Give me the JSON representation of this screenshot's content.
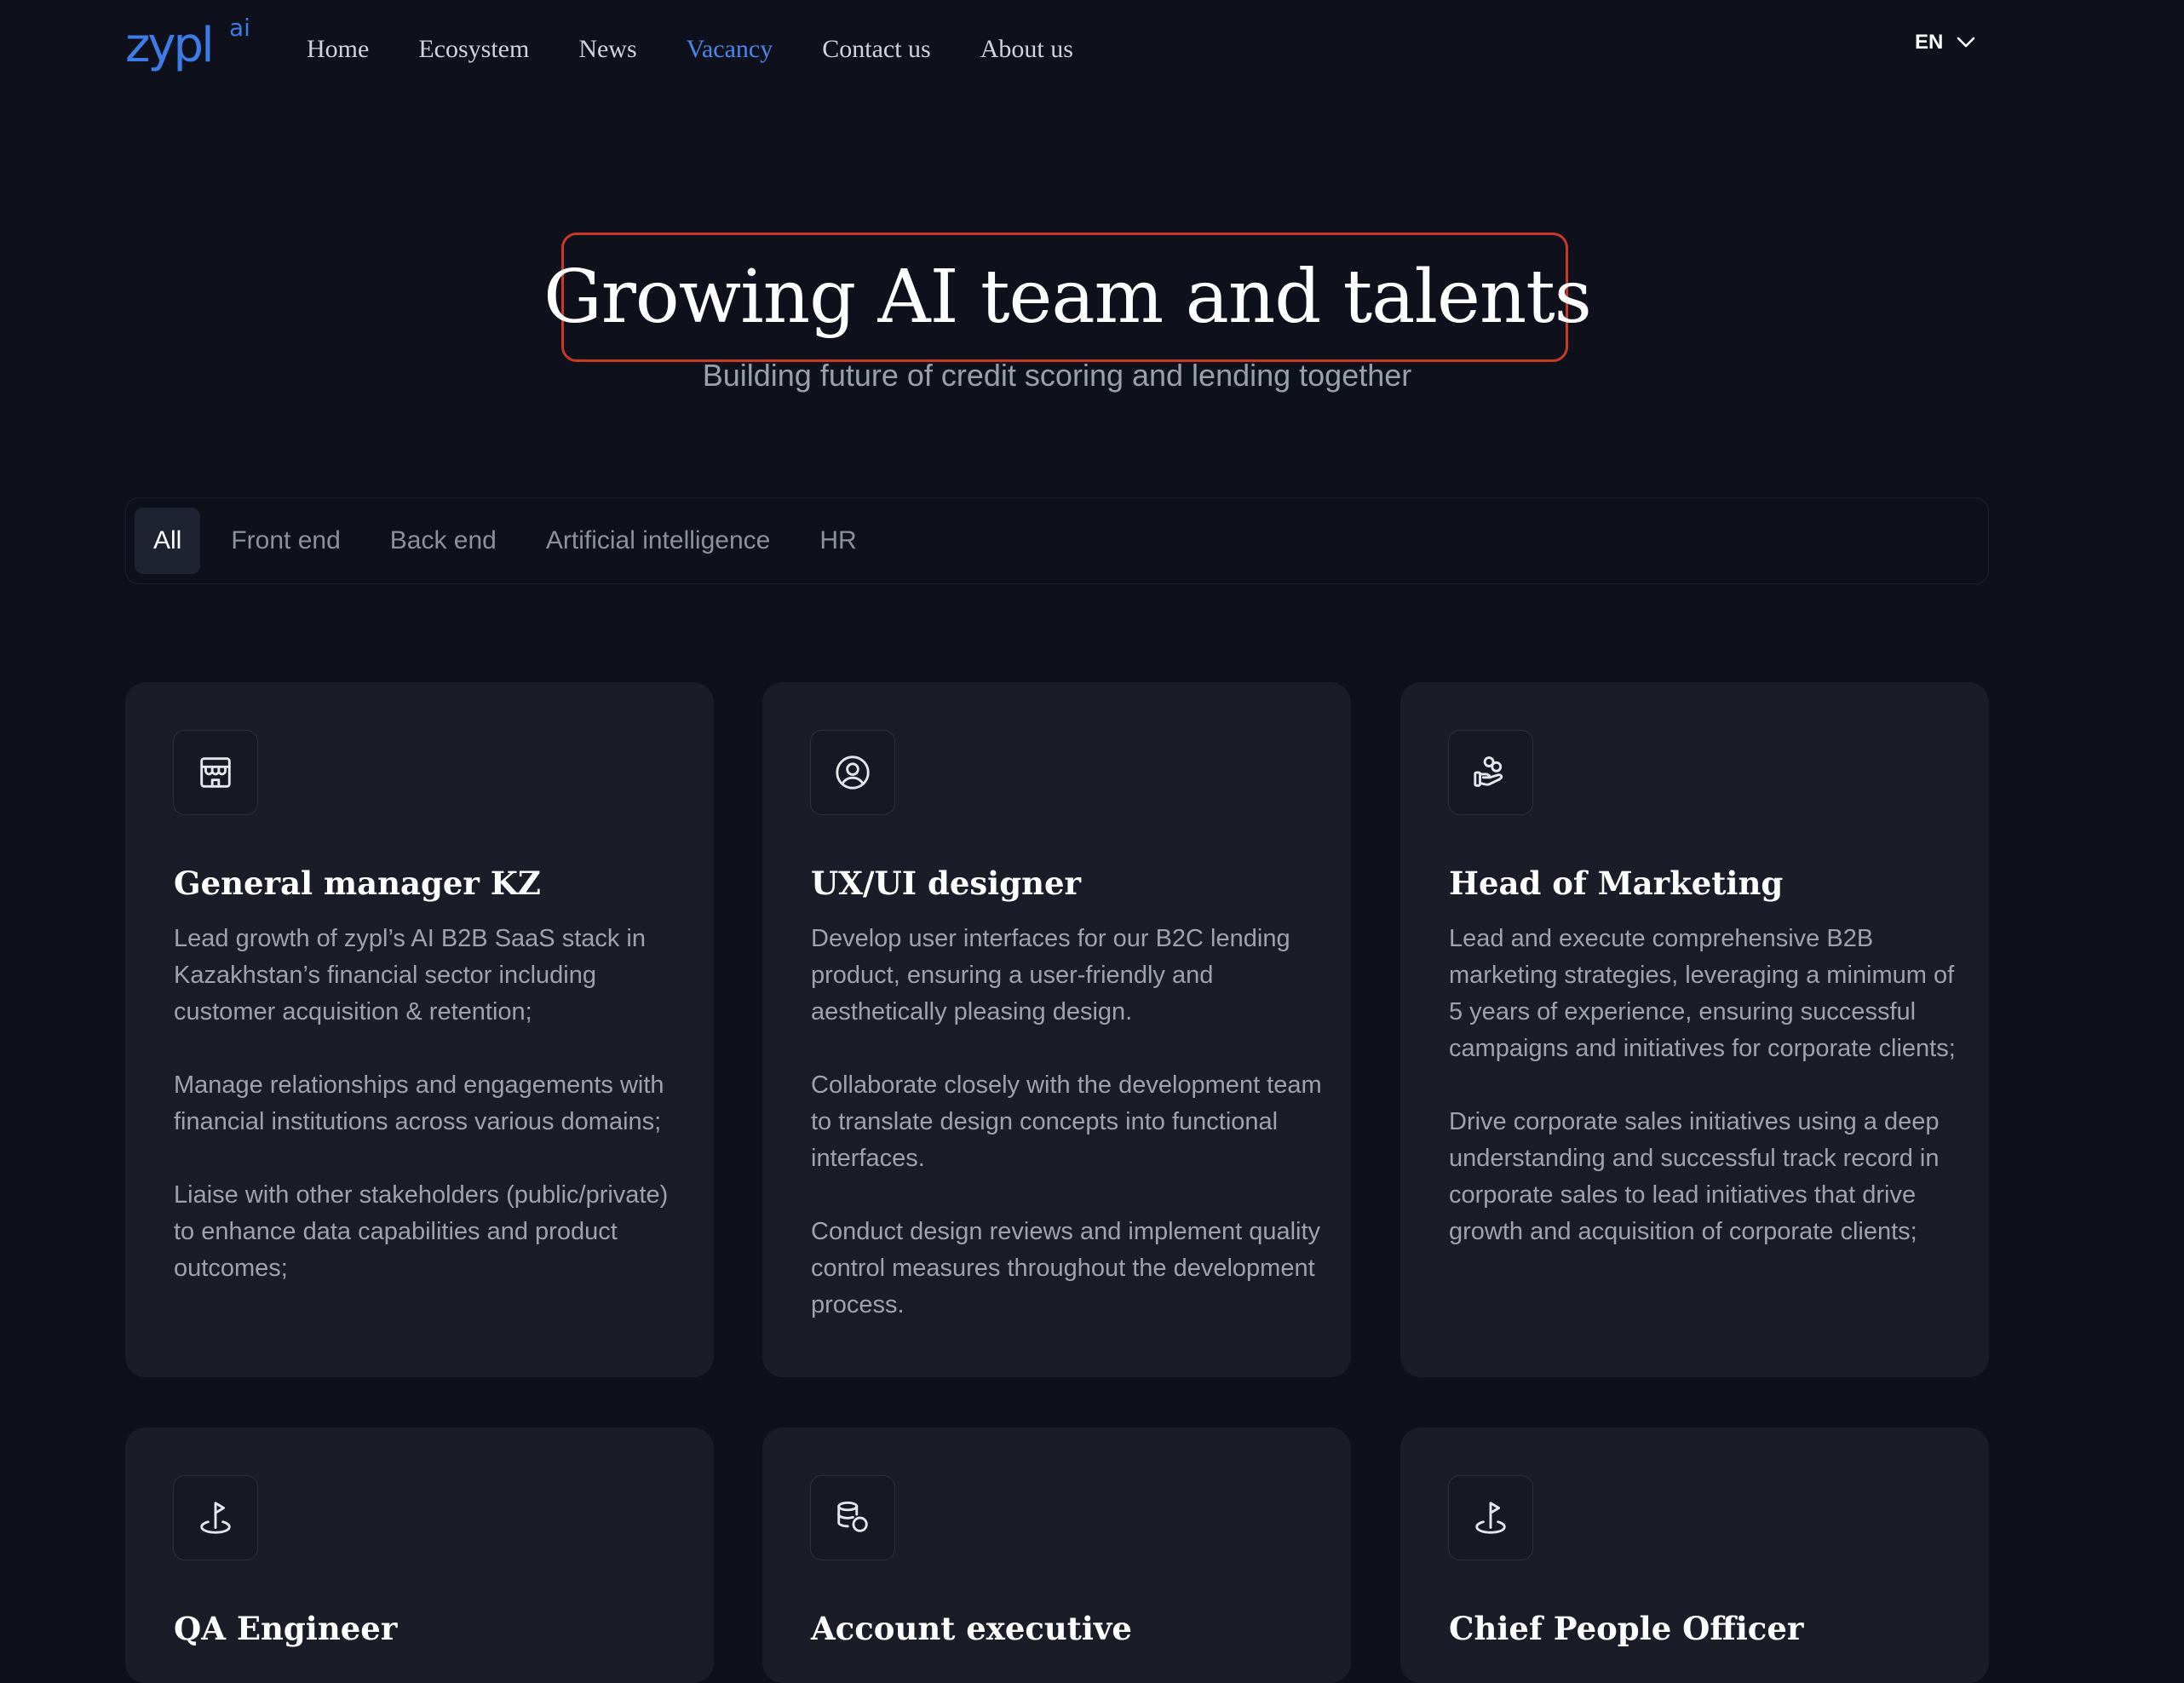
{
  "nav": {
    "logo_main": "zypl",
    "logo_sup": "ai",
    "links": [
      "Home",
      "Ecosystem",
      "News",
      "Vacancy",
      "Contact us",
      "About us"
    ],
    "language": "EN"
  },
  "hero": {
    "title": "Growing AI team and talents",
    "subtitle": "Building future of credit scoring and lending together"
  },
  "filters": [
    "All",
    "Front end",
    "Back end",
    "Artificial intelligence",
    "HR"
  ],
  "cards": [
    {
      "icon": "building-icon",
      "title": "General manager KZ",
      "paragraphs": [
        "Lead growth of zypl’s AI B2B SaaS stack in Kazakhstan’s financial sector including customer acquisition & retention;",
        "Manage relationships and engagements with financial institutions across various domains;",
        "Liaise with other stakeholders (public/private) to enhance data capabilities and product outcomes;"
      ]
    },
    {
      "icon": "user-circle-icon",
      "title": "UX/UI designer",
      "paragraphs": [
        "Develop user interfaces for our B2C lending product, ensuring a user-friendly and aesthetically pleasing design.",
        "Collaborate closely with the development team to translate design concepts into functional interfaces.",
        "Conduct design reviews and implement quality control measures throughout the development process."
      ]
    },
    {
      "icon": "hand-coins-icon",
      "title": "Head of Marketing",
      "paragraphs": [
        "Lead and execute comprehensive B2B marketing strategies, leveraging a minimum of 5 years of experience, ensuring successful campaigns and initiatives for corporate clients;",
        "Drive corporate sales initiatives using a deep understanding and successful track record in corporate sales to lead initiatives that drive growth and acquisition of corporate clients;"
      ]
    },
    {
      "icon": "flag-pin-icon",
      "title": "QA Engineer",
      "paragraphs": []
    },
    {
      "icon": "coins-stack-icon",
      "title": "Account executive",
      "paragraphs": []
    },
    {
      "icon": "flag-pin-icon",
      "title": "Chief People Officer",
      "paragraphs": []
    }
  ]
}
